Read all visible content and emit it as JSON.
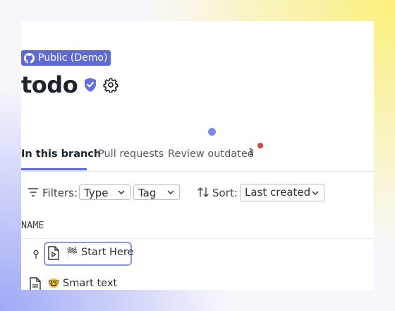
{
  "repo": {
    "badge_label": "Public (Demo)",
    "title": "todo"
  },
  "tabs": [
    {
      "label": "In this branch",
      "active": true
    },
    {
      "label": "Pull requests",
      "active": false
    },
    {
      "label": "Review outdated",
      "active": false,
      "count": "1"
    }
  ],
  "filters": {
    "label": "Filters:",
    "type_select": "Type",
    "tag_select": "Tag",
    "sort_label": "Sort:",
    "sort_select": "Last created"
  },
  "table": {
    "column_header": "NAME",
    "rows": [
      {
        "icon": "video-file-icon",
        "emoji": "🏁",
        "label": "Start Here",
        "pinned": true,
        "selected": true
      },
      {
        "icon": "text-file-icon",
        "emoji": "🤓",
        "label": "Smart text",
        "pinned": false,
        "selected": false
      }
    ]
  },
  "colors": {
    "accent": "#5e6ad2",
    "notification": "#c9473d"
  }
}
